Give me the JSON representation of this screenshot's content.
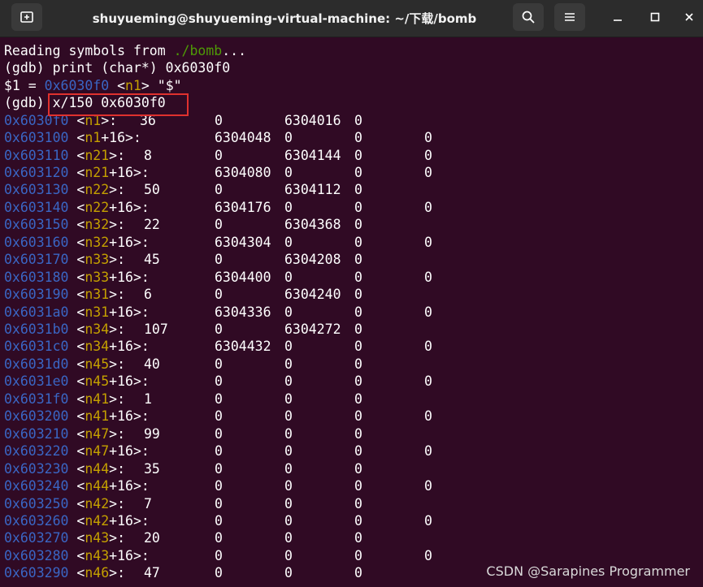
{
  "window": {
    "title": "shuyueming@shuyueming-virtual-machine: ~/下载/bomb"
  },
  "colors": {
    "terminal_bg": "#300a24",
    "address": "#3a66c4",
    "symbol": "#c4a000",
    "highlight_box": "#e0312e"
  },
  "header_lines": {
    "reading_prefix": "Reading symbols from ",
    "reading_path": "./bomb",
    "reading_suffix": "...",
    "print_cmd": "(gdb) print (char*) 0x6030f0",
    "result_prefix": "$1 = ",
    "result_addr": "0x6030f0",
    "result_sym": "n1",
    "result_value": " \"$\"",
    "prompt": "(gdb) ",
    "x_cmd": "x/150 0x6030f0"
  },
  "memory_rows": [
    {
      "addr": "0x6030f0",
      "sym": "n1",
      "off": "",
      "c1": "36",
      "c2": "0",
      "c3": "6304016",
      "c4": "0",
      "c5": ""
    },
    {
      "addr": "0x603100",
      "sym": "n1",
      "off": "+16",
      "c1": "",
      "c2": "6304048",
      "c3": "0",
      "c4": "0",
      "c5": "0"
    },
    {
      "addr": "0x603110",
      "sym": "n21",
      "off": "",
      "c1": "8",
      "c2": "0",
      "c3": "6304144",
      "c4": "0",
      "c5": "0"
    },
    {
      "addr": "0x603120",
      "sym": "n21",
      "off": "+16",
      "c1": "",
      "c2": "6304080",
      "c3": "0",
      "c4": "0",
      "c5": "0"
    },
    {
      "addr": "0x603130",
      "sym": "n22",
      "off": "",
      "c1": "50",
      "c2": "0",
      "c3": "6304112",
      "c4": "0",
      "c5": ""
    },
    {
      "addr": "0x603140",
      "sym": "n22",
      "off": "+16",
      "c1": "",
      "c2": "6304176",
      "c3": "0",
      "c4": "0",
      "c5": "0"
    },
    {
      "addr": "0x603150",
      "sym": "n32",
      "off": "",
      "c1": "22",
      "c2": "0",
      "c3": "6304368",
      "c4": "0",
      "c5": ""
    },
    {
      "addr": "0x603160",
      "sym": "n32",
      "off": "+16",
      "c1": "",
      "c2": "6304304",
      "c3": "0",
      "c4": "0",
      "c5": "0"
    },
    {
      "addr": "0x603170",
      "sym": "n33",
      "off": "",
      "c1": "45",
      "c2": "0",
      "c3": "6304208",
      "c4": "0",
      "c5": ""
    },
    {
      "addr": "0x603180",
      "sym": "n33",
      "off": "+16",
      "c1": "",
      "c2": "6304400",
      "c3": "0",
      "c4": "0",
      "c5": "0"
    },
    {
      "addr": "0x603190",
      "sym": "n31",
      "off": "",
      "c1": "6",
      "c2": "0",
      "c3": "6304240",
      "c4": "0",
      "c5": ""
    },
    {
      "addr": "0x6031a0",
      "sym": "n31",
      "off": "+16",
      "c1": "",
      "c2": "6304336",
      "c3": "0",
      "c4": "0",
      "c5": "0"
    },
    {
      "addr": "0x6031b0",
      "sym": "n34",
      "off": "",
      "c1": "107",
      "c2": "0",
      "c3": "6304272",
      "c4": "0",
      "c5": ""
    },
    {
      "addr": "0x6031c0",
      "sym": "n34",
      "off": "+16",
      "c1": "",
      "c2": "6304432",
      "c3": "0",
      "c4": "0",
      "c5": "0"
    },
    {
      "addr": "0x6031d0",
      "sym": "n45",
      "off": "",
      "c1": "40",
      "c2": "0",
      "c3": "0",
      "c4": "0",
      "c5": ""
    },
    {
      "addr": "0x6031e0",
      "sym": "n45",
      "off": "+16",
      "c1": "",
      "c2": "0",
      "c3": "0",
      "c4": "0",
      "c5": "0"
    },
    {
      "addr": "0x6031f0",
      "sym": "n41",
      "off": "",
      "c1": "1",
      "c2": "0",
      "c3": "0",
      "c4": "0",
      "c5": ""
    },
    {
      "addr": "0x603200",
      "sym": "n41",
      "off": "+16",
      "c1": "",
      "c2": "0",
      "c3": "0",
      "c4": "0",
      "c5": "0"
    },
    {
      "addr": "0x603210",
      "sym": "n47",
      "off": "",
      "c1": "99",
      "c2": "0",
      "c3": "0",
      "c4": "0",
      "c5": ""
    },
    {
      "addr": "0x603220",
      "sym": "n47",
      "off": "+16",
      "c1": "",
      "c2": "0",
      "c3": "0",
      "c4": "0",
      "c5": "0"
    },
    {
      "addr": "0x603230",
      "sym": "n44",
      "off": "",
      "c1": "35",
      "c2": "0",
      "c3": "0",
      "c4": "0",
      "c5": ""
    },
    {
      "addr": "0x603240",
      "sym": "n44",
      "off": "+16",
      "c1": "",
      "c2": "0",
      "c3": "0",
      "c4": "0",
      "c5": "0"
    },
    {
      "addr": "0x603250",
      "sym": "n42",
      "off": "",
      "c1": "7",
      "c2": "0",
      "c3": "0",
      "c4": "0",
      "c5": ""
    },
    {
      "addr": "0x603260",
      "sym": "n42",
      "off": "+16",
      "c1": "",
      "c2": "0",
      "c3": "0",
      "c4": "0",
      "c5": "0"
    },
    {
      "addr": "0x603270",
      "sym": "n43",
      "off": "",
      "c1": "20",
      "c2": "0",
      "c3": "0",
      "c4": "0",
      "c5": ""
    },
    {
      "addr": "0x603280",
      "sym": "n43",
      "off": "+16",
      "c1": "",
      "c2": "0",
      "c3": "0",
      "c4": "0",
      "c5": "0"
    },
    {
      "addr": "0x603290",
      "sym": "n46",
      "off": "",
      "c1": "47",
      "c2": "0",
      "c3": "0",
      "c4": "0",
      "c5": ""
    }
  ],
  "watermark": "CSDN @Sarapines Programmer"
}
